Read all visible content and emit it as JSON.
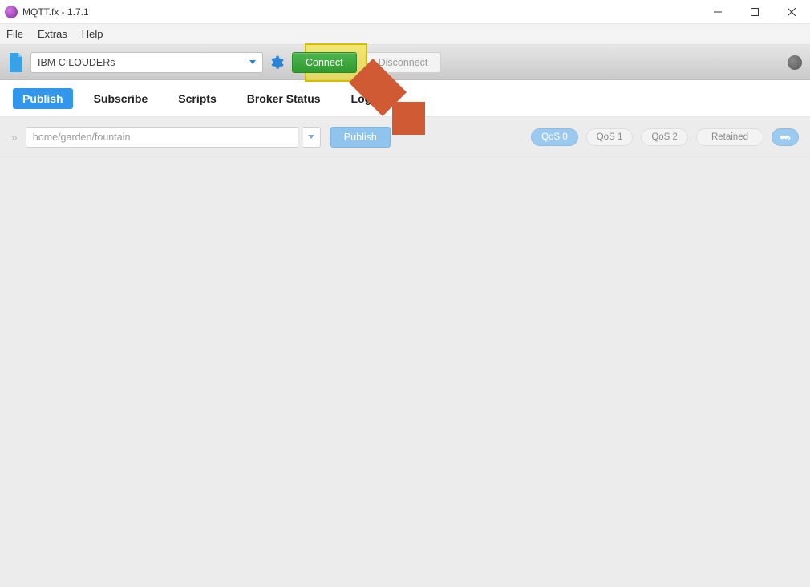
{
  "window": {
    "title": "MQTT.fx - 1.7.1"
  },
  "menu": {
    "items": [
      "File",
      "Extras",
      "Help"
    ]
  },
  "connection": {
    "profile": "IBM C:LOUDERs",
    "connect_label": "Connect",
    "disconnect_label": "Disconnect"
  },
  "tabs": {
    "items": [
      "Publish",
      "Subscribe",
      "Scripts",
      "Broker Status",
      "Log"
    ],
    "active_index": 0
  },
  "publish": {
    "topic_value": "home/garden/fountain",
    "publish_label": "Publish",
    "qos": {
      "options": [
        "QoS 0",
        "QoS 1",
        "QoS 2"
      ],
      "selected_index": 0
    },
    "retained_label": "Retained"
  }
}
